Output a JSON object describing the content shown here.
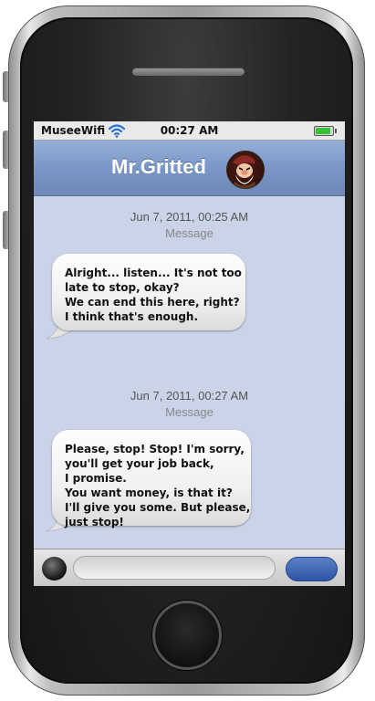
{
  "status_bar": {
    "carrier": "MuseeWifi",
    "time": "00:27 AM",
    "wifi_icon": "wifi-icon",
    "battery_icon": "battery-icon",
    "battery_level": 1.0
  },
  "header": {
    "contact_name": "Mr.Gritted",
    "avatar_icon": "avatar-dwarf-grumpy"
  },
  "messages": [
    {
      "timestamp": "Jun 7, 2011, 00:25 AM",
      "type_label": "Message",
      "lines": [
        "Alright... listen... It's not too",
        "late to stop, okay?",
        "We can end this here, right?",
        "I think that's enough."
      ]
    },
    {
      "timestamp": "Jun 7, 2011, 00:27 AM",
      "type_label": "Message",
      "lines": [
        "Please, stop! Stop! I'm sorry,",
        "you'll get your job back,",
        "I promise.",
        "You want money, is that it?",
        "I'll give you some. But please,",
        "just stop!"
      ]
    }
  ],
  "input_bar": {
    "camera_icon": "camera-icon",
    "text_value": "",
    "send_label": ""
  },
  "colors": {
    "header": "#7a96c6",
    "screen_background": "#cbd3e8",
    "send_button": "#2c55a5",
    "battery": "#35c235"
  }
}
